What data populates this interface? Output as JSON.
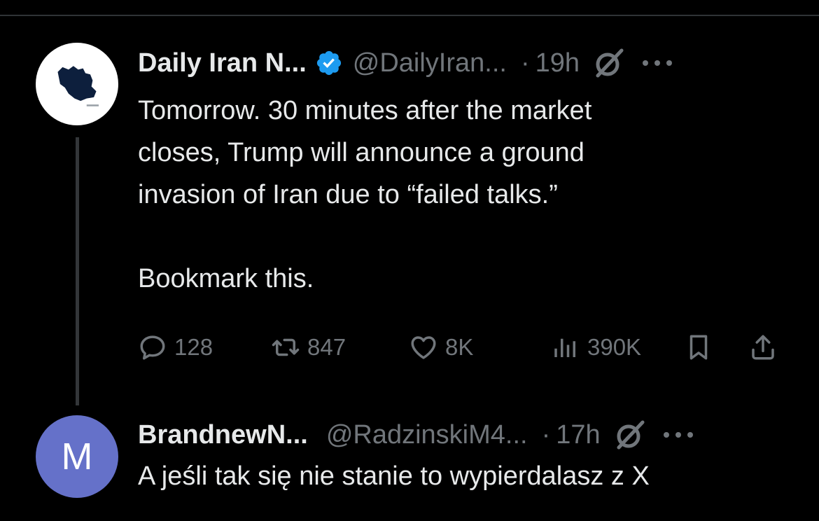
{
  "tweets": [
    {
      "author": "Daily Iran N...",
      "handle": "@DailyIran...",
      "separator": "·",
      "time": "19h",
      "verified": true,
      "avatar_icon": "iran-map-logo",
      "text_lines": [
        "Tomorrow. 30 minutes after the market",
        "closes, Trump will announce a ground",
        "invasion of Iran due to “failed talks.”",
        "",
        "Bookmark this."
      ],
      "stats": {
        "replies": "128",
        "reposts": "847",
        "likes": "8K",
        "views": "390K"
      }
    },
    {
      "author": "BrandnewN...",
      "handle": "@RadzinskiM4...",
      "separator": "·",
      "time": "17h",
      "avatar_letter": "M",
      "avatar_color": "#6571c9",
      "text": "A jeśli tak się nie stanie to wypierdalasz z X"
    }
  ],
  "colors": {
    "background": "#000000",
    "text": "#e7e9ea",
    "muted": "#71767b",
    "verified": "#1d9bf0"
  }
}
